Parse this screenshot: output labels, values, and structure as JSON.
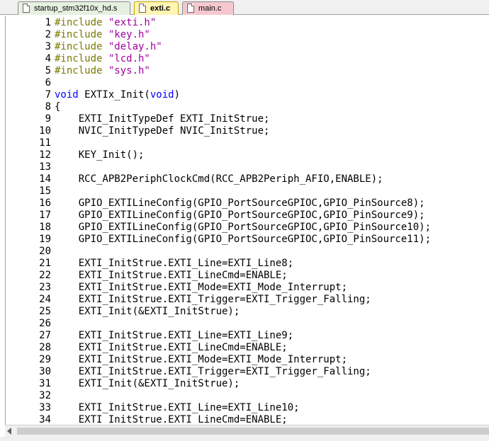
{
  "tabs": [
    {
      "label": "startup_stm32f10x_hd.s",
      "active": false,
      "color": "#e6f0e0"
    },
    {
      "label": "exti.c",
      "active": true,
      "color": "#fff5b4"
    },
    {
      "label": "main.c",
      "active": false,
      "color": "#f5c8d0"
    }
  ],
  "colors": {
    "preprocessor": "#7a7a00",
    "string": "#a000a0",
    "keyword": "#0000ff",
    "text": "#000000"
  },
  "lines": [
    {
      "n": "1",
      "segs": [
        {
          "t": "#include ",
          "c": "pp"
        },
        {
          "t": "\"exti.h\"",
          "c": "str"
        }
      ]
    },
    {
      "n": "2",
      "segs": [
        {
          "t": "#include ",
          "c": "pp"
        },
        {
          "t": "\"key.h\"",
          "c": "str"
        }
      ]
    },
    {
      "n": "3",
      "segs": [
        {
          "t": "#include ",
          "c": "pp"
        },
        {
          "t": "\"delay.h\"",
          "c": "str"
        }
      ]
    },
    {
      "n": "4",
      "segs": [
        {
          "t": "#include ",
          "c": "pp"
        },
        {
          "t": "\"lcd.h\"",
          "c": "str"
        }
      ]
    },
    {
      "n": "5",
      "segs": [
        {
          "t": "#include ",
          "c": "pp"
        },
        {
          "t": "\"sys.h\"",
          "c": "str"
        }
      ]
    },
    {
      "n": "6",
      "segs": []
    },
    {
      "n": "7",
      "segs": [
        {
          "t": "void",
          "c": "kw"
        },
        {
          "t": " EXTIx_Init(",
          "c": ""
        },
        {
          "t": "void",
          "c": "kw"
        },
        {
          "t": ")",
          "c": ""
        }
      ]
    },
    {
      "n": "8",
      "segs": [
        {
          "t": "{",
          "c": ""
        }
      ]
    },
    {
      "n": "9",
      "segs": [
        {
          "t": "    EXTI_InitTypeDef EXTI_InitStrue;",
          "c": ""
        }
      ]
    },
    {
      "n": "10",
      "segs": [
        {
          "t": "    NVIC_InitTypeDef NVIC_InitStrue;",
          "c": ""
        }
      ]
    },
    {
      "n": "11",
      "segs": []
    },
    {
      "n": "12",
      "segs": [
        {
          "t": "    KEY_Init();",
          "c": ""
        }
      ]
    },
    {
      "n": "13",
      "segs": []
    },
    {
      "n": "14",
      "segs": [
        {
          "t": "    RCC_APB2PeriphClockCmd(RCC_APB2Periph_AFIO,ENABLE);",
          "c": ""
        }
      ]
    },
    {
      "n": "15",
      "segs": []
    },
    {
      "n": "16",
      "segs": [
        {
          "t": "    GPIO_EXTILineConfig(GPIO_PortSourceGPIOC,GPIO_PinSource8);",
          "c": ""
        }
      ]
    },
    {
      "n": "17",
      "segs": [
        {
          "t": "    GPIO_EXTILineConfig(GPIO_PortSourceGPIOC,GPIO_PinSource9);",
          "c": ""
        }
      ]
    },
    {
      "n": "18",
      "segs": [
        {
          "t": "    GPIO_EXTILineConfig(GPIO_PortSourceGPIOC,GPIO_PinSource10);",
          "c": ""
        }
      ]
    },
    {
      "n": "19",
      "segs": [
        {
          "t": "    GPIO_EXTILineConfig(GPIO_PortSourceGPIOC,GPIO_PinSource11);",
          "c": ""
        }
      ]
    },
    {
      "n": "20",
      "segs": []
    },
    {
      "n": "21",
      "segs": [
        {
          "t": "    EXTI_InitStrue.EXTI_Line=EXTI_Line8;",
          "c": ""
        }
      ]
    },
    {
      "n": "22",
      "segs": [
        {
          "t": "    EXTI_InitStrue.EXTI_LineCmd=ENABLE;",
          "c": ""
        }
      ]
    },
    {
      "n": "23",
      "segs": [
        {
          "t": "    EXTI_InitStrue.EXTI_Mode=EXTI_Mode_Interrupt;",
          "c": ""
        }
      ]
    },
    {
      "n": "24",
      "segs": [
        {
          "t": "    EXTI_InitStrue.EXTI_Trigger=EXTI_Trigger_Falling;",
          "c": ""
        }
      ]
    },
    {
      "n": "25",
      "segs": [
        {
          "t": "    EXTI_Init(&EXTI_InitStrue);",
          "c": ""
        }
      ]
    },
    {
      "n": "26",
      "segs": []
    },
    {
      "n": "27",
      "segs": [
        {
          "t": "    EXTI_InitStrue.EXTI_Line=EXTI_Line9;",
          "c": ""
        }
      ]
    },
    {
      "n": "28",
      "segs": [
        {
          "t": "    EXTI_InitStrue.EXTI_LineCmd=ENABLE;",
          "c": ""
        }
      ]
    },
    {
      "n": "29",
      "segs": [
        {
          "t": "    EXTI_InitStrue.EXTI_Mode=EXTI_Mode_Interrupt;",
          "c": ""
        }
      ]
    },
    {
      "n": "30",
      "segs": [
        {
          "t": "    EXTI_InitStrue.EXTI_Trigger=EXTI_Trigger_Falling;",
          "c": ""
        }
      ]
    },
    {
      "n": "31",
      "segs": [
        {
          "t": "    EXTI_Init(&EXTI_InitStrue);",
          "c": ""
        }
      ]
    },
    {
      "n": "32",
      "segs": []
    },
    {
      "n": "33",
      "segs": [
        {
          "t": "    EXTI_InitStrue.EXTI_Line=EXTI_Line10;",
          "c": ""
        }
      ]
    },
    {
      "n": "34",
      "segs": [
        {
          "t": "    EXTI_InitStrue.EXTI_LineCmd=ENABLE;",
          "c": ""
        }
      ]
    }
  ]
}
